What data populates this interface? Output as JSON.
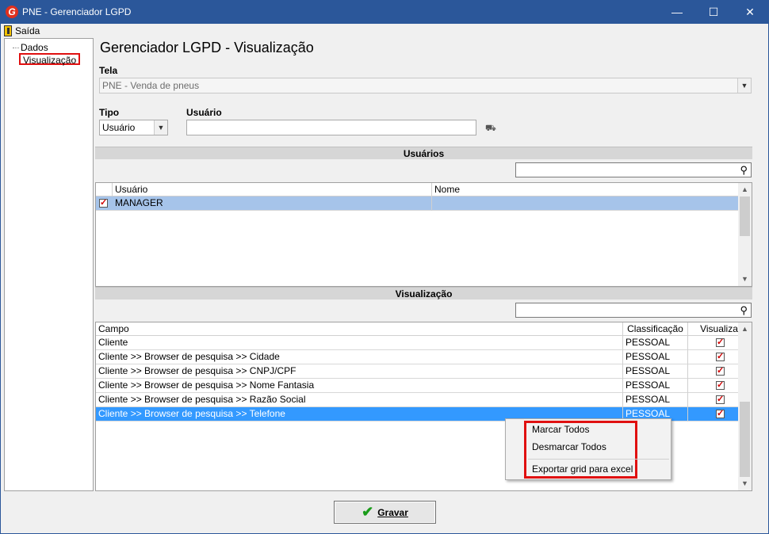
{
  "window": {
    "title": "PNE - Gerenciador LGPD",
    "logo_letter": "G",
    "minimize": "—",
    "maximize": "☐",
    "close": "✕"
  },
  "menu": {
    "exit_label": "Saída"
  },
  "tree": {
    "items": [
      {
        "label": "Dados"
      },
      {
        "label": "Visualização"
      }
    ]
  },
  "main": {
    "heading": "Gerenciador LGPD - Visualização",
    "tela_label": "Tela",
    "tela_value": "PNE - Venda de pneus",
    "tipo_label": "Tipo",
    "tipo_value": "Usuário",
    "usuario_label": "Usuário",
    "usuario_value": ""
  },
  "usuarios_section": {
    "title": "Usuários",
    "columns": [
      "Usuário",
      "Nome"
    ],
    "rows": [
      {
        "usuario": "MANAGER",
        "nome": "",
        "checked": true
      }
    ]
  },
  "visualizacao_section": {
    "title": "Visualização",
    "columns": [
      "Campo",
      "Classificação",
      "Visualizar"
    ],
    "rows": [
      {
        "campo": "Cliente",
        "classificacao": "PESSOAL",
        "visualizar": true
      },
      {
        "campo": "Cliente >> Browser de pesquisa >> Cidade",
        "classificacao": "PESSOAL",
        "visualizar": true
      },
      {
        "campo": "Cliente >> Browser de pesquisa >> CNPJ/CPF",
        "classificacao": "PESSOAL",
        "visualizar": true
      },
      {
        "campo": "Cliente >> Browser de pesquisa >> Nome Fantasia",
        "classificacao": "PESSOAL",
        "visualizar": true
      },
      {
        "campo": "Cliente >> Browser de pesquisa >> Razão Social",
        "classificacao": "PESSOAL",
        "visualizar": true
      },
      {
        "campo": "Cliente >> Browser de pesquisa >> Telefone",
        "classificacao": "PESSOAL",
        "visualizar": true
      }
    ]
  },
  "context_menu": {
    "items": [
      "Marcar Todos",
      "Desmarcar Todos",
      "Exportar grid para excel"
    ]
  },
  "footer": {
    "gravar_label": "Gravar"
  }
}
